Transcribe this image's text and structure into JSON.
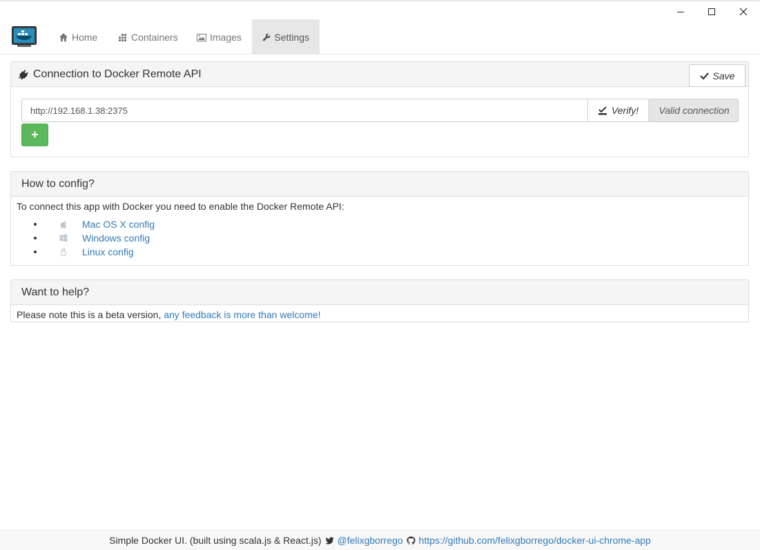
{
  "window": {
    "minimize_label": "minimize",
    "maximize_label": "maximize",
    "close_label": "close"
  },
  "nav": {
    "home": "Home",
    "containers": "Containers",
    "images": "Images",
    "settings": "Settings"
  },
  "connection_panel": {
    "title": "Connection to Docker Remote API",
    "save_label": "Save",
    "url_value": "http://192.168.1.38:2375",
    "verify_label": "Verify!",
    "status_label": "Valid connection",
    "add_label": "+"
  },
  "config_panel": {
    "title": "How to config?",
    "intro": "To connect this app with Docker you need to enable the Docker Remote API:",
    "links": [
      {
        "label": "Mac OS X config",
        "icon": "apple-icon"
      },
      {
        "label": "Windows config",
        "icon": "windows-icon"
      },
      {
        "label": "Linux config",
        "icon": "linux-icon"
      }
    ]
  },
  "help_panel": {
    "title": "Want to help?",
    "text": "Please note this is a beta version, ",
    "link": "any feedback is more than welcome!"
  },
  "footer": {
    "text": "Simple Docker UI. (built using scala.js & React.js)",
    "twitter": "@felixgborrego",
    "github": "https://github.com/felixgborrego/docker-ui-chrome-app"
  },
  "colors": {
    "link": "#337ab7",
    "success": "#5cb85c",
    "active_nav": "#e7e7e7"
  }
}
